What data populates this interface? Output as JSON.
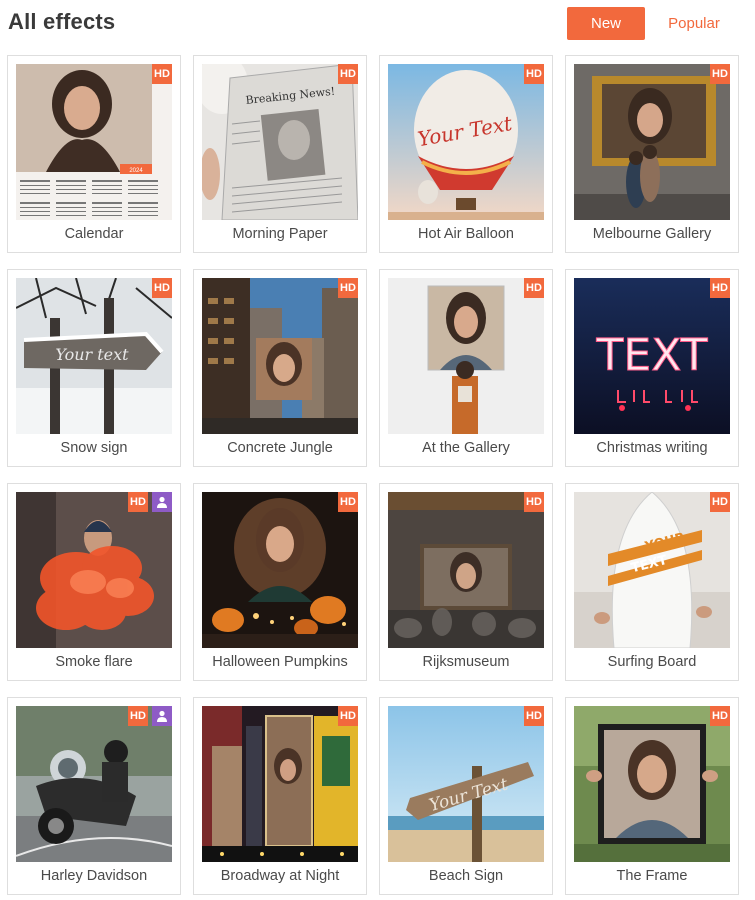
{
  "header": {
    "title": "All effects",
    "tabs": {
      "new_label": "New",
      "popular_label": "Popular"
    }
  },
  "colors": {
    "accent": "#f2693d",
    "user_badge": "#8e5bc6",
    "card_border": "#dedede"
  },
  "effects": [
    {
      "label": "Calendar",
      "hd": "HD",
      "user_badge": false,
      "calendar_year": "2024"
    },
    {
      "label": "Morning Paper",
      "hd": "HD",
      "user_badge": false,
      "headline": "Breaking News!"
    },
    {
      "label": "Hot Air Balloon",
      "hd": "HD",
      "user_badge": false,
      "overlay_text": "Your Text"
    },
    {
      "label": "Melbourne Gallery",
      "hd": "HD",
      "user_badge": false
    },
    {
      "label": "Snow sign",
      "hd": "HD",
      "user_badge": false,
      "overlay_text": "Your text"
    },
    {
      "label": "Concrete Jungle",
      "hd": "HD",
      "user_badge": false
    },
    {
      "label": "At the Gallery",
      "hd": "HD",
      "user_badge": false
    },
    {
      "label": "Christmas writing",
      "hd": "HD",
      "user_badge": false,
      "overlay_text": "TEXT"
    },
    {
      "label": "Smoke flare",
      "hd": "HD",
      "user_badge": true
    },
    {
      "label": "Halloween Pumpkins",
      "hd": "HD",
      "user_badge": false
    },
    {
      "label": "Rijksmuseum",
      "hd": "HD",
      "user_badge": false
    },
    {
      "label": "Surfing Board",
      "hd": "HD",
      "user_badge": false,
      "overlay_text_1": "YOUR",
      "overlay_text_2": "TEXT"
    },
    {
      "label": "Harley Davidson",
      "hd": "HD",
      "user_badge": true
    },
    {
      "label": "Broadway at Night",
      "hd": "HD",
      "user_badge": false
    },
    {
      "label": "Beach Sign",
      "hd": "HD",
      "user_badge": false,
      "overlay_text": "Your Text"
    },
    {
      "label": "The Frame",
      "hd": "HD",
      "user_badge": false
    }
  ]
}
